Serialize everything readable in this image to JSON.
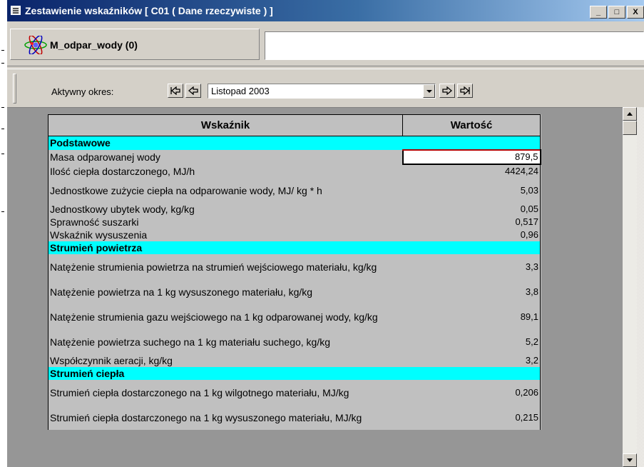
{
  "window": {
    "title": "Zestawienie wskaźników [ C01 ( Dane rzeczywiste ) ]",
    "buttons": {
      "minimize": "_",
      "maximize": "□",
      "close": "X"
    }
  },
  "indicator": {
    "name": "M_odpar_wody (0)",
    "description": ""
  },
  "toolbar": {
    "period_label": "Aktywny okres:",
    "period_value": "Listopad 2003"
  },
  "table": {
    "header": {
      "name": "Wskaźnik",
      "value": "Wartość"
    },
    "sections": [
      {
        "title": "Podstawowe",
        "rows": [
          {
            "name": "Masa odparowanej wody",
            "value": "879,5"
          },
          {
            "name": "Ilość ciepła dostarczonego, MJ/h",
            "value": "4424,24"
          },
          {
            "name": "Jednostkowe zużycie ciepła na odparowanie wody, MJ/ kg * h",
            "value": "5,03"
          },
          {
            "name": "Jednostkowy ubytek wody, kg/kg",
            "value": "0,05"
          },
          {
            "name": "Sprawność suszarki",
            "value": "0,517"
          },
          {
            "name": "Wskaźnik wysuszenia",
            "value": "0,96"
          }
        ]
      },
      {
        "title": "Strumień powietrza",
        "rows": [
          {
            "name": "Natężenie strumienia powietrza na strumień wejściowego materiału, kg/kg",
            "value": "3,3"
          },
          {
            "name": "Natężenie powietrza na 1 kg wysuszonego materiału, kg/kg",
            "value": "3,8"
          },
          {
            "name": "Natężenie strumienia gazu wejściowego na 1 kg odparowanej wody, kg/kg",
            "value": "89,1"
          },
          {
            "name": "Natężenie powietrza suchego na 1 kg  materiału suchego, kg/kg",
            "value": "5,2"
          },
          {
            "name": "Współczynnik aeracji, kg/kg",
            "value": "3,2"
          }
        ]
      },
      {
        "title": "Strumień ciepła",
        "rows": [
          {
            "name": "Strumień ciepła dostarczonego na 1 kg wilgotnego materiału, MJ/kg",
            "value": "0,206"
          },
          {
            "name": "Strumień ciepła dostarczonego na 1 kg wysuszonego materiału, MJ/kg",
            "value": "0,215"
          }
        ]
      }
    ]
  }
}
